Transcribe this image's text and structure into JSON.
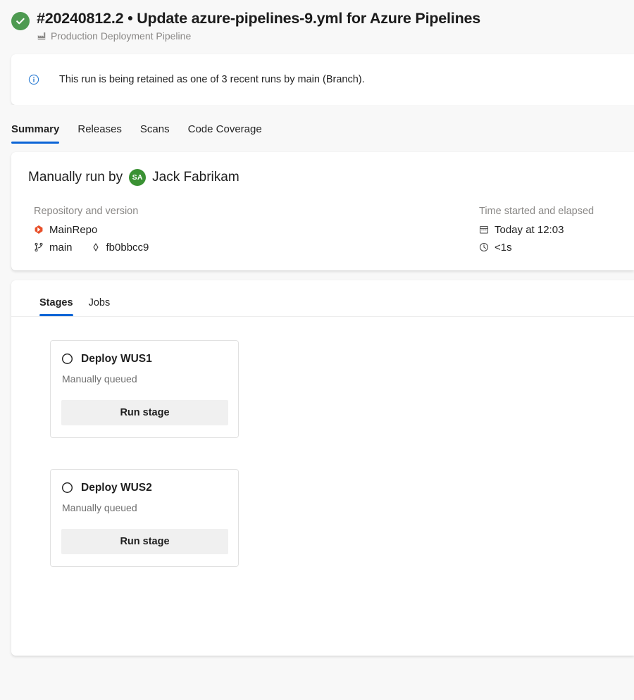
{
  "header": {
    "status_icon": "check-circle-icon",
    "status_color": "#4e9a51",
    "run_title": "#20240812.2 • Update azure-pipelines-9.yml for Azure Pipelines",
    "pipeline_icon": "pipeline-factory-icon",
    "pipeline_name": "Production Deployment Pipeline"
  },
  "banner": {
    "icon": "info-circle-icon",
    "icon_color": "#0b64d6",
    "message": "This run is being retained as one of 3 recent runs by main (Branch)."
  },
  "main_tabs": [
    {
      "label": "Summary",
      "active": true
    },
    {
      "label": "Releases",
      "active": false
    },
    {
      "label": "Scans",
      "active": false
    },
    {
      "label": "Code Coverage",
      "active": false
    }
  ],
  "summary": {
    "run_by_prefix": "Manually run by",
    "avatar_initials": "SA",
    "avatar_color": "#3a9133",
    "user_name": "Jack Fabrikam",
    "repository": {
      "label": "Repository and version",
      "repo_icon": "azure-repos-git-icon",
      "repo_name": "MainRepo",
      "branch_icon": "branch-icon",
      "branch_name": "main",
      "commit_icon": "commit-icon",
      "commit_hash": "fb0bbcc9"
    },
    "time": {
      "label": "Time started and elapsed",
      "calendar_icon": "calendar-icon",
      "started": "Today at 12:03",
      "clock_icon": "clock-icon",
      "elapsed": "<1s"
    }
  },
  "stages_section": {
    "tabs": [
      {
        "label": "Stages",
        "active": true
      },
      {
        "label": "Jobs",
        "active": false
      }
    ],
    "stages": [
      {
        "status_icon": "empty-circle-icon",
        "name": "Deploy WUS1",
        "status_text": "Manually queued",
        "action_label": "Run stage"
      },
      {
        "status_icon": "empty-circle-icon",
        "name": "Deploy WUS2",
        "status_text": "Manually queued",
        "action_label": "Run stage"
      }
    ]
  },
  "accent_color": "#0b64d6"
}
